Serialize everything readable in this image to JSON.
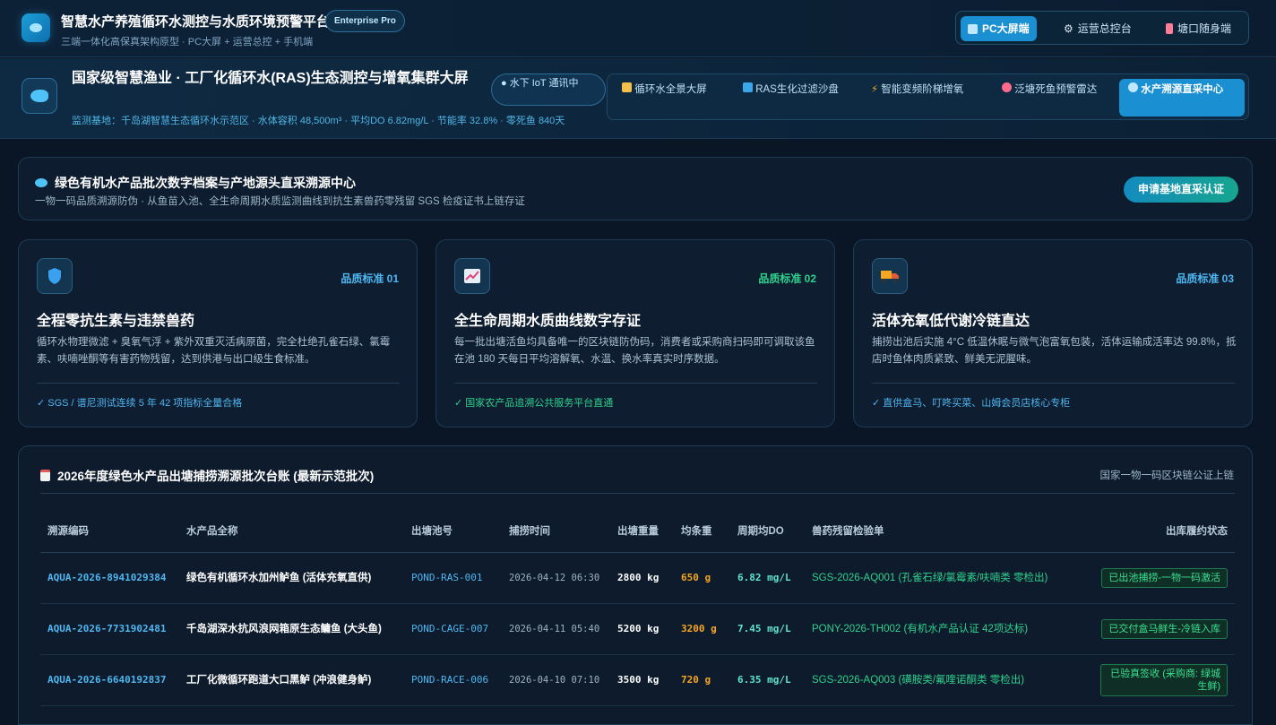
{
  "header": {
    "title": "智慧水产养殖循环水测控与水质环境预警平台",
    "badge": "Enterprise Pro",
    "subtitle": "三端一体化高保真架构原型 · PC大屏 + 运营总控 + 手机端",
    "views": [
      {
        "label": "PC大屏端",
        "icon": "monitor-icon",
        "active": true
      },
      {
        "label": "运营总控台",
        "icon": "gear-icon",
        "active": false
      },
      {
        "label": "塘口随身端",
        "icon": "mobile-icon",
        "active": false
      }
    ]
  },
  "module": {
    "title": "国家级智慧渔业 · 工厂化循环水(RAS)生态测控与增氧集群大屏",
    "meta": "监测基地：千岛湖智慧生态循环水示范区 · 水体容积 48,500m³ · 平均DO 6.82mg/L · 节能率 32.8% · 零死鱼 840天",
    "iot_status": "● 水下 IoT 通讯中",
    "tabs": [
      {
        "label": "循环水全景大屏",
        "icon": "bar-chart-icon",
        "active": false
      },
      {
        "label": "RAS生化过滤沙盘",
        "icon": "refresh-icon",
        "active": false
      },
      {
        "label": "智能变频阶梯增氧",
        "icon": "bolt-icon",
        "active": false
      },
      {
        "label": "泛塘死鱼预警雷达",
        "icon": "alarm-icon",
        "active": false
      },
      {
        "label": "水产溯源直采中心",
        "icon": "fish-icon",
        "active": true
      }
    ]
  },
  "banner": {
    "title": "绿色有机水产品批次数字档案与产地源头直采溯源中心",
    "subtitle": "一物一码品质溯源防伪 · 从鱼苗入池、全生命周期水质监测曲线到抗生素兽药零残留 SGS 检疫证书上链存证",
    "button": "申请基地直采认证"
  },
  "cards": [
    {
      "icon": "shield-icon",
      "tag": "品质标准 01",
      "tag_color": "#4fb6f0",
      "title": "全程零抗生素与违禁兽药",
      "desc": "循环水物理微滤 + 臭氧气浮 + 紫外双重灭活病原菌，完全杜绝孔雀石绿、氯霉素、呋喃唑酮等有害药物残留，达到供港与出口级生食标准。",
      "foot": "✓ SGS / 谱尼测试连续 5 年 42 项指标全量合格",
      "foot_color": "#4fb6f0"
    },
    {
      "icon": "trend-chart-icon",
      "tag": "品质标准 02",
      "tag_color": "#2fd28d",
      "title": "全生命周期水质曲线数字存证",
      "desc": "每一批出塘活鱼均具备唯一的区块链防伪码，消费者或采购商扫码即可调取该鱼在池 180 天每日平均溶解氧、水温、换水率真实时序数据。",
      "foot": "✓ 国家农产品追溯公共服务平台直通",
      "foot_color": "#2fd28d"
    },
    {
      "icon": "truck-icon",
      "tag": "品质标准 03",
      "tag_color": "#4fb6f0",
      "title": "活体充氧低代谢冷链直达",
      "desc": "捕捞出池后实施 4°C 低温休眠与微气泡富氧包装，活体运输成活率达 99.8%，抵店时鱼体肉质紧致、鲜美无泥腥味。",
      "foot": "✓ 直供盒马、叮咚买菜、山姆会员店核心专柜",
      "foot_color": "#4fb6f0"
    }
  ],
  "ledger": {
    "title": "2026年度绿色水产品出塘捕捞溯源批次台账 (最新示范批次)",
    "note": "国家一物一码区块链公证上链",
    "columns": [
      "溯源编码",
      "水产品全称",
      "出塘池号",
      "捕捞时间",
      "出塘重量",
      "均条重",
      "周期均DO",
      "兽药残留检验单",
      "出库履约状态"
    ],
    "rows": [
      {
        "code": "AQUA-2026-8941029384",
        "name": "绿色有机循环水加州鲈鱼 (活体充氧直供)",
        "pond": "POND-RAS-001",
        "time": "2026-04-12 06:30",
        "weight": "2800 kg",
        "avg": "650 g",
        "do": "6.82 mg/L",
        "test": "SGS-2026-AQ001 (孔雀石绿/氯霉素/呋喃类 零检出)",
        "status": "已出池捕捞-一物一码激活"
      },
      {
        "code": "AQUA-2026-7731902481",
        "name": "千岛湖深水抗风浪网箱原生态鳙鱼 (大头鱼)",
        "pond": "POND-CAGE-007",
        "time": "2026-04-11 05:40",
        "weight": "5200 kg",
        "avg": "3200 g",
        "do": "7.45 mg/L",
        "test": "PONY-2026-TH002 (有机水产品认证 42项达标)",
        "status": "已交付盒马鲜生-冷链入库"
      },
      {
        "code": "AQUA-2026-6640192837",
        "name": "工厂化微循环跑道大口黑鲈 (冲浪健身鲈)",
        "pond": "POND-RACE-006",
        "time": "2026-04-10 07:10",
        "weight": "3500 kg",
        "avg": "720 g",
        "do": "6.35 mg/L",
        "test": "SGS-2026-AQ003 (磺胺类/氟喹诺酮类 零检出)",
        "status": "已验真签收 (采购商: 绿城生鲜)"
      }
    ]
  }
}
